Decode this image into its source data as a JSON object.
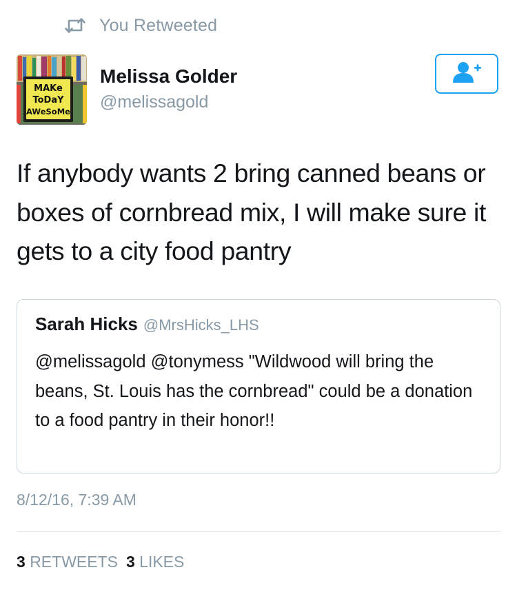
{
  "retweet_context": {
    "icon": "retweet-icon",
    "text": "You Retweeted"
  },
  "author": {
    "avatar_text": [
      "MAKe",
      "ToDaY",
      "AWeSoMe"
    ],
    "display_name": "Melissa Golder",
    "handle": "@melissagold"
  },
  "follow_button": {
    "icon": "add-user-icon",
    "accent": "#1da1f2"
  },
  "tweet": {
    "text": "If anybody wants 2 bring canned beans or boxes of cornbread mix, I will make sure it gets to a city food pantry"
  },
  "quoted_tweet": {
    "display_name": "Sarah Hicks",
    "handle": "@MrsHicks_LHS",
    "text": "@melissagold @tonymess \"Wildwood will bring the beans, St. Louis has the cornbread\" could be a donation to a food pantry in their honor!!"
  },
  "timestamp": "8/12/16, 7:39 AM",
  "stats": {
    "retweets_count": "3",
    "retweets_label": "RETWEETS",
    "likes_count": "3",
    "likes_label": "LIKES"
  },
  "colors": {
    "text": "#14171a",
    "secondary": "#8899a6",
    "border": "#ccd6dd",
    "accent": "#1da1f2"
  }
}
